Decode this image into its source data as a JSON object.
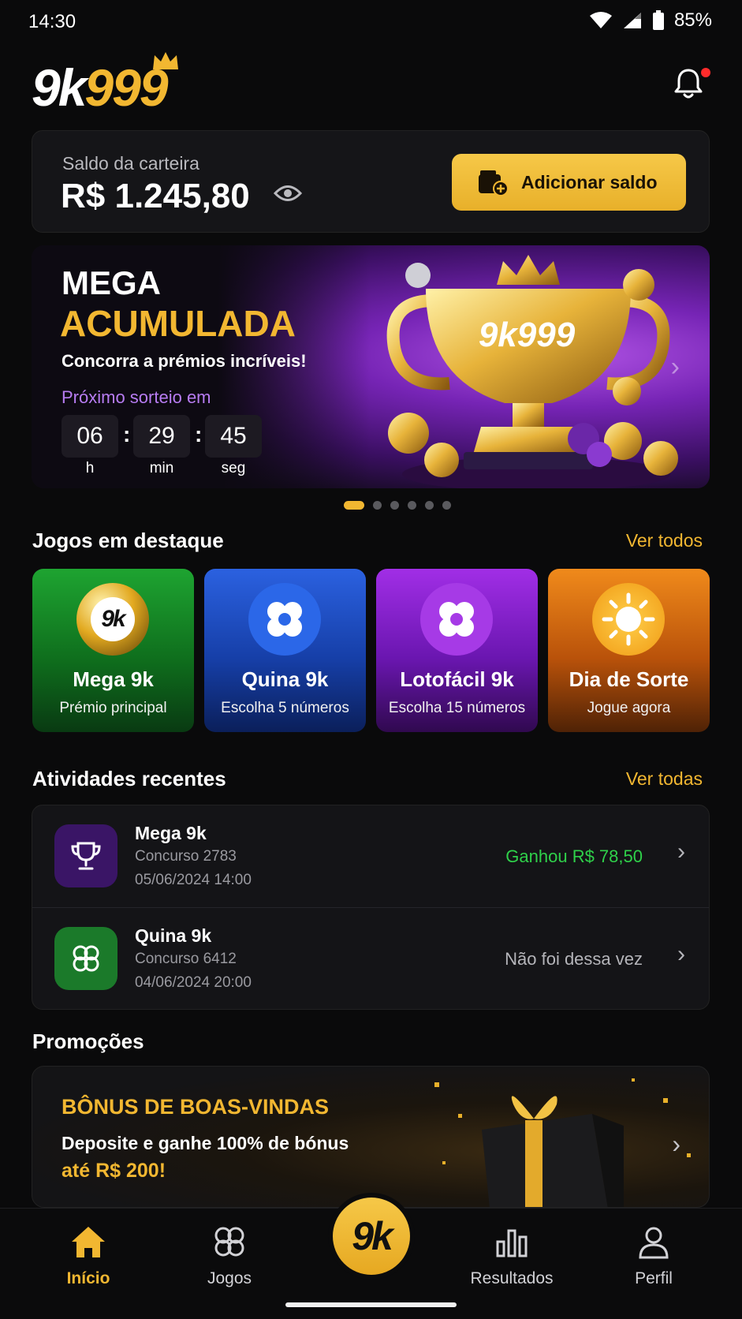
{
  "status_bar": {
    "time": "14:30",
    "battery": "85%"
  },
  "header": {
    "logo_part1": "9k",
    "logo_part2": "999"
  },
  "wallet": {
    "label": "Saldo da carteira",
    "amount": "R$ 1.245,80",
    "add_button": "Adicionar saldo"
  },
  "banner": {
    "title_line1": "MEGA",
    "title_line2": "ACUMULADA",
    "subtitle": "Concorra a prémios incríveis!",
    "next_draw_label": "Próximo sorteio em",
    "trophy_text": "9k999",
    "countdown": {
      "hours": "06",
      "minutes": "29",
      "seconds": "45",
      "unit_h": "h",
      "unit_min": "min",
      "unit_seg": "seg",
      "sep": ":"
    },
    "slides_total": 6,
    "active_slide": 1
  },
  "featured": {
    "title": "Jogos em destaque",
    "link": "Ver todos",
    "games": [
      {
        "icon_text": "9k",
        "name": "Mega 9k",
        "desc": "Prémio principal"
      },
      {
        "name": "Quina 9k",
        "desc": "Escolha 5 números"
      },
      {
        "name": "Lotofácil 9k",
        "desc": "Escolha 15 números"
      },
      {
        "name": "Dia de Sorte",
        "desc": "Jogue agora"
      }
    ]
  },
  "recent": {
    "title": "Atividades recentes",
    "link": "Ver todas",
    "items": [
      {
        "game": "Mega 9k",
        "contest": "Concurso 2783",
        "datetime": "05/06/2024 14:00",
        "status": "Ganhou R$ 78,50"
      },
      {
        "game": "Quina 9k",
        "contest": "Concurso 6412",
        "datetime": "04/06/2024 20:00",
        "status": "Não foi dessa vez"
      }
    ]
  },
  "promotions": {
    "title": "Promoções",
    "card_title": "BÔNUS DE BOAS-VINDAS",
    "card_line1": "Deposite e ganhe 100% de bónus",
    "card_line2": "até R$ 200!"
  },
  "nav": {
    "home": "Início",
    "games": "Jogos",
    "center": "9k",
    "results": "Resultados",
    "profile": "Perfil"
  },
  "colors": {
    "accent": "#f2b731",
    "win": "#2fd14a",
    "bg": "#0a0a0b"
  }
}
